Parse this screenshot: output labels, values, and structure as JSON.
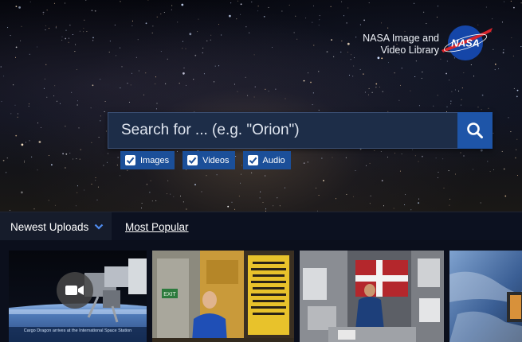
{
  "brand": {
    "line1": "NASA Image and",
    "line2": "Video Library",
    "logo_text": "NASA"
  },
  "search": {
    "placeholder": "Search for ... (e.g. \"Orion\")",
    "button_icon": "search-icon"
  },
  "filters": [
    {
      "label": "Images",
      "checked": true
    },
    {
      "label": "Videos",
      "checked": true
    },
    {
      "label": "Audio",
      "checked": true
    }
  ],
  "nav": {
    "active_tab": "Newest Uploads",
    "other_tab": "Most Popular"
  },
  "thumbnails": [
    {
      "kind": "video",
      "icon": "video-camera-icon",
      "caption": "Cargo Dragon arrives at the International Space Station"
    },
    {
      "kind": "image",
      "sign_text": "EXIT"
    },
    {
      "kind": "image"
    },
    {
      "kind": "image"
    }
  ],
  "colors": {
    "search_button": "#1e55a8",
    "search_field": "#1d2d48",
    "filter_chip": "#1b4f99",
    "nav_bg": "#0c1120"
  }
}
